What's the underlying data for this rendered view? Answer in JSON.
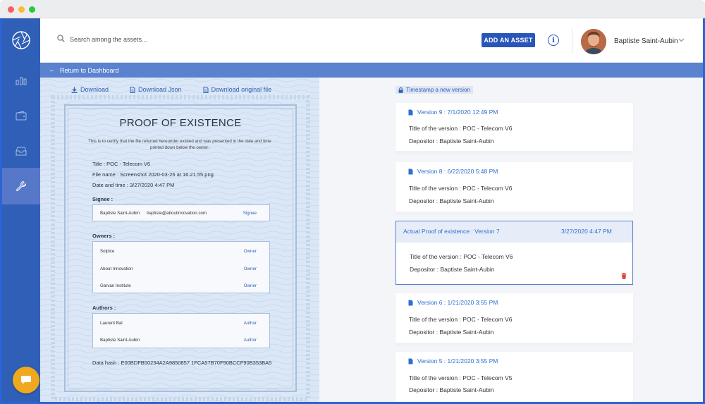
{
  "header": {
    "search_placeholder": "Search among the assets...",
    "add_asset_label": "ADD AN ASSET",
    "info_label": "i",
    "user_name": "Baptiste Saint-Aubin"
  },
  "return_bar": {
    "label": "Return to Dashboard"
  },
  "downloads": {
    "download": "Download",
    "download_json": "Download Json",
    "download_original": "Download original file"
  },
  "certificate": {
    "title": "PROOF OF EXISTENCE",
    "intro": "This is to certify that the file referred hereunder existed and was presented in the date and time printed down below the owner:",
    "title_field": "Title : POC - Telecom V6",
    "file_name_field": "File name : Screenshot 2020-03-26 at 16.21.55.png",
    "date_field": "Date and time : 3/27/2020 4:47 PM",
    "signee_label": "Signee :",
    "signee": {
      "name": "Baptiste Saint-Aubin",
      "email": "baptiste@aboutinnovation.com",
      "role": "Signee"
    },
    "owners_label": "Owners :",
    "owners": [
      {
        "name": "Solpice",
        "role": "Owner"
      },
      {
        "name": "About Innovation",
        "role": "Owner"
      },
      {
        "name": "Garvan Institute",
        "role": "Owner"
      }
    ],
    "authors_label": "Authors :",
    "authors": [
      {
        "name": "Laurent Bal",
        "role": "Author"
      },
      {
        "name": "Baptiste Saint-Aubin",
        "role": "Author"
      }
    ],
    "data_hash": "Data hash : E00BDFB50234A2A9850857 1FCA57B70F90BCCF90B353BA5"
  },
  "versions": {
    "timestamp_label": "Timestamp a new version",
    "items": [
      {
        "header": "Version 9 :  7/1/2020 12:49 PM",
        "title": "Title of the version : POC - Telecom V6",
        "depositor": "Depositor : Baptiste Saint-Aubin"
      },
      {
        "header": "Version 8 :  6/22/2020 5:48 PM",
        "title": "Title of the version : POC - Telecom V6",
        "depositor": "Depositor : Baptiste Saint-Aubin"
      },
      {
        "header": "Actual Proof of existence : Version 7",
        "date": "3/27/2020 4:47 PM",
        "title": "Title of the version : POC - Telecom V6",
        "depositor": "Depositor : Baptiste Saint-Aubin"
      },
      {
        "header": "Version 6 :  1/21/2020 3:55 PM",
        "title": "Title of the version : POC - Telecom V6",
        "depositor": "Depositor : Baptiste Saint-Aubin"
      },
      {
        "header": "Version 5 :  1/21/2020 3:55 PM",
        "title": "Title of the version : POC - Telecom V5",
        "depositor": "Depositor : Baptiste Saint-Aubin"
      }
    ]
  },
  "colors": {
    "sidebar": "#2f5fb7",
    "accent": "#2855b8",
    "link": "#2f6fcf",
    "chat": "#f0a91f",
    "delete": "#e03c31"
  },
  "icons": [
    "aperture-logo-icon",
    "bar-chart-icon",
    "wallet-icon",
    "inbox-icon",
    "wrench-icon",
    "chat-icon",
    "search-icon",
    "info-icon",
    "chevron-down-icon",
    "arrow-left-icon",
    "download-icon",
    "document-icon",
    "lock-icon",
    "trash-icon"
  ]
}
